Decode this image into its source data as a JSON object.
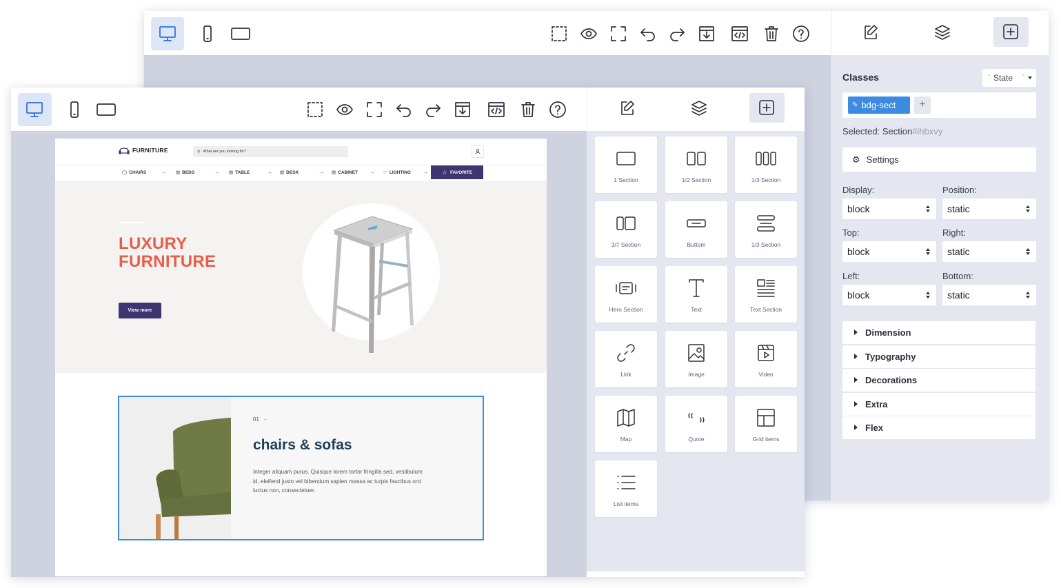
{
  "back_window": {
    "panel": {
      "classes_label": "Classes",
      "state_label": "State",
      "class_tag": "bdg-sect",
      "add_class": "+",
      "selected_label": "Selected: Section",
      "selected_id": "#ihbxvy",
      "settings_label": "Settings",
      "fields": [
        {
          "label": "Display:",
          "value": "block"
        },
        {
          "label": "Position:",
          "value": "static"
        },
        {
          "label": "Top:",
          "value": "block"
        },
        {
          "label": "Right:",
          "value": "static"
        },
        {
          "label": "Left:",
          "value": "block"
        },
        {
          "label": "Bottom:",
          "value": "static"
        }
      ],
      "sections": [
        "Dimension",
        "Typography",
        "Decorations",
        "Extra",
        "Flex"
      ]
    }
  },
  "front_window": {
    "blocks": [
      {
        "label": "1 Section",
        "icon": "one-section-icon"
      },
      {
        "label": "1/2 Section",
        "icon": "half-section-icon"
      },
      {
        "label": "1/3 Section",
        "icon": "third-section-icon"
      },
      {
        "label": "3/7 Section",
        "icon": "three-seven-section-icon"
      },
      {
        "label": "Buttom",
        "icon": "button-icon"
      },
      {
        "label": "1/3 Section",
        "icon": "third-section-rows-icon"
      },
      {
        "label": "Hero Section",
        "icon": "hero-section-icon"
      },
      {
        "label": "Text",
        "icon": "text-icon"
      },
      {
        "label": "Text Section",
        "icon": "text-section-icon"
      },
      {
        "label": "Link",
        "icon": "link-icon"
      },
      {
        "label": "Image",
        "icon": "image-icon"
      },
      {
        "label": "Video",
        "icon": "video-icon"
      },
      {
        "label": "Map",
        "icon": "map-icon"
      },
      {
        "label": "Quote",
        "icon": "quote-icon"
      },
      {
        "label": "Grid items",
        "icon": "grid-items-icon"
      },
      {
        "label": "List items",
        "icon": "list-items-icon"
      }
    ]
  },
  "site": {
    "brand": "FURNITURE",
    "search_placeholder": "What are you looking for?",
    "nav": [
      "CHAIRS",
      "BEDS",
      "TABLE",
      "DESK",
      "CABINET",
      "LIGHTING"
    ],
    "favorite": "FAVORITE",
    "hero_line1": "LUXURY",
    "hero_line2": "FURNITURE",
    "hero_button": "View more",
    "section_number": "01",
    "section_dash": "-",
    "section_title": "chairs & sofas",
    "section_text": "Integer aliquam purus. Quisque lorem tortor fringilla sed, vestibulum id, eleifend justo vel bibendum sapien massa ac turpis faucibus orci luctus non, consectetuer."
  },
  "colors": {
    "accent_blue": "#2a6fdb",
    "canvas": "#cfd3e0",
    "panel": "#e4e6f0",
    "hero_text": "#e85d48",
    "purple": "#3d3470",
    "title_navy": "#1f3d57"
  }
}
